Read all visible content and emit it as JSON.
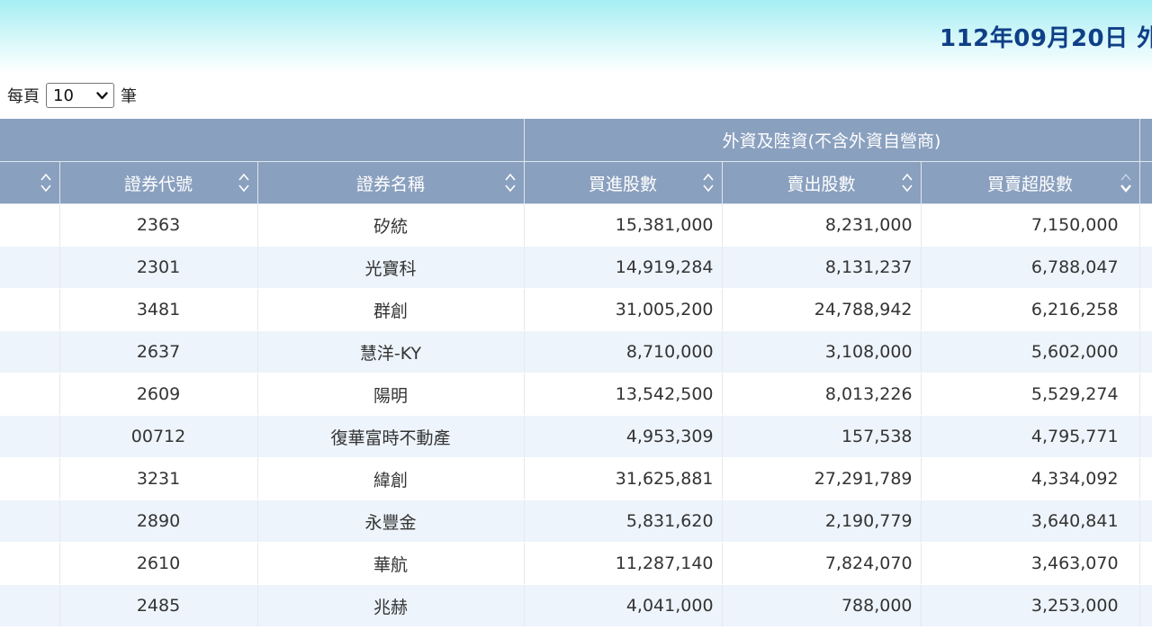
{
  "header": {
    "title": "112年09月20日 外"
  },
  "page_size": {
    "prefix": "每頁",
    "selected": "10",
    "suffix": "筆"
  },
  "table": {
    "group_header": "外資及陸資(不含外資自營商)",
    "columns": [
      "",
      "證券代號",
      "證券名稱",
      "買進股數",
      "賣出股數",
      "買賣超股數"
    ],
    "rows": [
      {
        "code": "2363",
        "name": "矽統",
        "buy": "15,381,000",
        "sell": "8,231,000",
        "net": "7,150,000"
      },
      {
        "code": "2301",
        "name": "光寶科",
        "buy": "14,919,284",
        "sell": "8,131,237",
        "net": "6,788,047"
      },
      {
        "code": "3481",
        "name": "群創",
        "buy": "31,005,200",
        "sell": "24,788,942",
        "net": "6,216,258"
      },
      {
        "code": "2637",
        "name": "慧洋-KY",
        "buy": "8,710,000",
        "sell": "3,108,000",
        "net": "5,602,000"
      },
      {
        "code": "2609",
        "name": "陽明",
        "buy": "13,542,500",
        "sell": "8,013,226",
        "net": "5,529,274"
      },
      {
        "code": "00712",
        "name": "復華富時不動產",
        "buy": "4,953,309",
        "sell": "157,538",
        "net": "4,795,771"
      },
      {
        "code": "3231",
        "name": "緯創",
        "buy": "31,625,881",
        "sell": "27,291,789",
        "net": "4,334,092"
      },
      {
        "code": "2890",
        "name": "永豐金",
        "buy": "5,831,620",
        "sell": "2,190,779",
        "net": "3,640,841"
      },
      {
        "code": "2610",
        "name": "華航",
        "buy": "11,287,140",
        "sell": "7,824,070",
        "net": "3,463,070"
      },
      {
        "code": "2485",
        "name": "兆赫",
        "buy": "4,041,000",
        "sell": "788,000",
        "net": "3,253,000"
      }
    ]
  },
  "colors": {
    "header_bg": "#8aa0bf",
    "title": "#0f3f87",
    "row_alt": "#edf4fb"
  }
}
